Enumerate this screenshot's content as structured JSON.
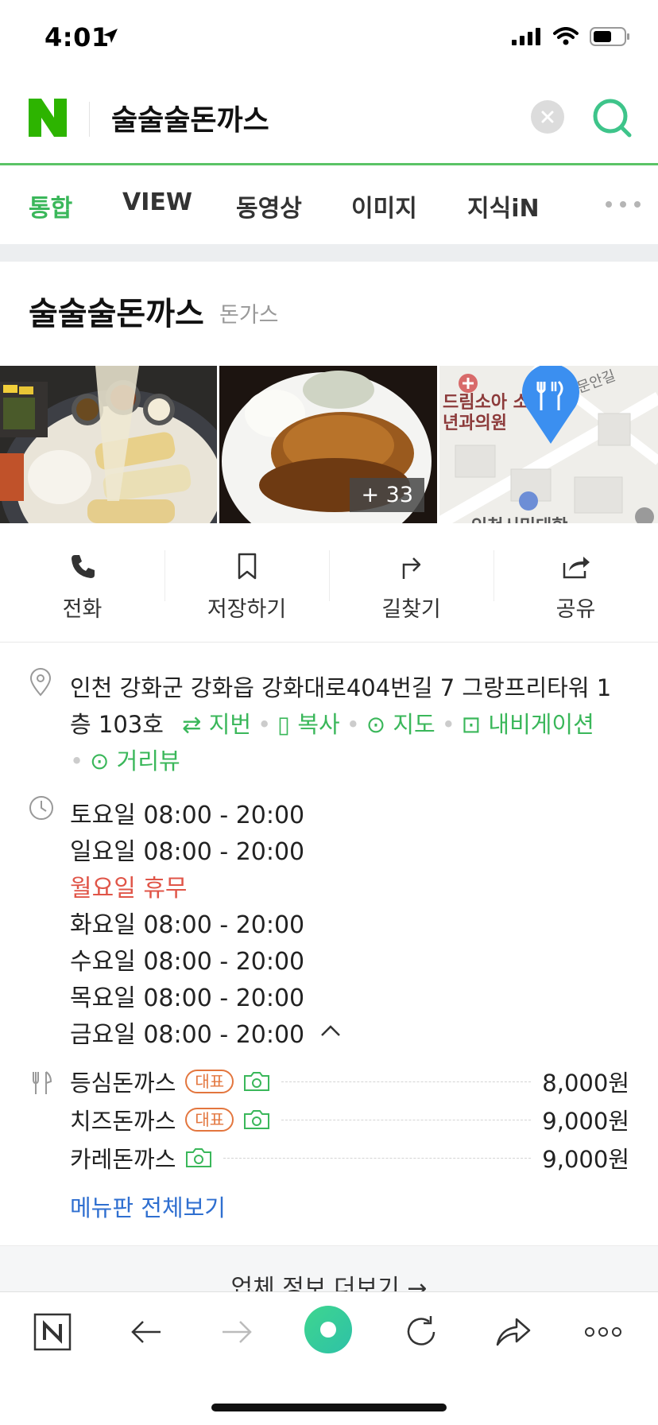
{
  "status": {
    "time": "4:01"
  },
  "search": {
    "query": "술술술돈까스"
  },
  "tabs": [
    {
      "label": "통합"
    },
    {
      "label": "VIEW"
    },
    {
      "label": "동영상"
    },
    {
      "label": "이미지"
    },
    {
      "label": "지식iN"
    }
  ],
  "place": {
    "name": "술술술돈까스",
    "category": "돈가스",
    "photo_more": "+ 33",
    "map_labels": {
      "clinic": "드림소아 소년과의원",
      "street": "문안길",
      "college": "인천시민대학"
    }
  },
  "actions": [
    {
      "label": "전화",
      "icon": "phone-icon"
    },
    {
      "label": "저장하기",
      "icon": "bookmark-icon"
    },
    {
      "label": "길찾기",
      "icon": "directions-icon"
    },
    {
      "label": "공유",
      "icon": "share-icon"
    }
  ],
  "address": {
    "line1": "인천 강화군 강화읍 강화대로404번길 7 그랑프리타워 1",
    "line2": "층 103호",
    "links": {
      "jibun": "지번",
      "copy": "복사",
      "map": "지도",
      "navigation": "내비게이션",
      "streetview": "거리뷰"
    }
  },
  "hours": [
    "토요일 08:00 - 20:00",
    "일요일 08:00 - 20:00",
    "월요일 휴무",
    "화요일 08:00 - 20:00",
    "수요일 08:00 - 20:00",
    "목요일 08:00 - 20:00",
    "금요일 08:00 - 20:00"
  ],
  "menu": {
    "items": [
      {
        "name": "등심돈까스",
        "badge": "대표",
        "price": "8,000원"
      },
      {
        "name": "치즈돈까스",
        "badge": "대표",
        "price": "9,000원"
      },
      {
        "name": "카레돈까스",
        "badge": "",
        "price": "9,000원"
      }
    ],
    "view_all": "메뉴판 전체보기"
  },
  "more_info": "업체 정보 더보기 →",
  "colors": {
    "accent_green": "#3ab75a",
    "closed_red": "#e05548",
    "link_blue": "#2f6fd0",
    "badge_orange": "#e3763e"
  }
}
